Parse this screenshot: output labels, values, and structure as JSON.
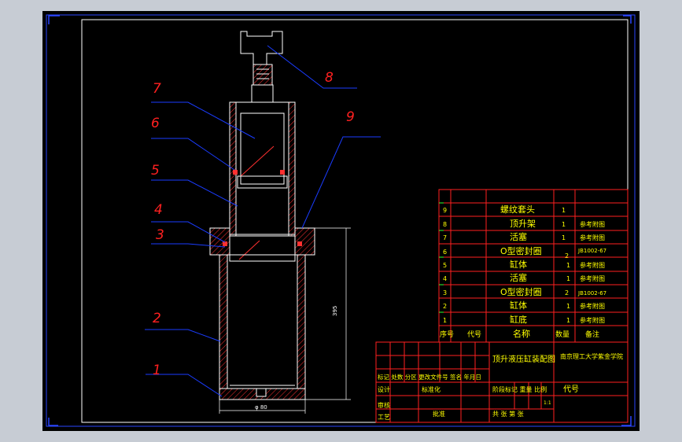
{
  "drawing": {
    "balloons": [
      "1",
      "2",
      "3",
      "4",
      "5",
      "6",
      "7",
      "8",
      "9"
    ],
    "dimensions": {
      "height": "395",
      "diameter": "φ 80"
    }
  },
  "bom": {
    "rows": [
      {
        "seq": "9",
        "name": "螺纹套头",
        "qty": "1",
        "note": ""
      },
      {
        "seq": "8",
        "name": "顶升架",
        "qty": "1",
        "note": "参考附图"
      },
      {
        "seq": "7",
        "name": "活塞",
        "qty": "1",
        "note": "参考附图"
      },
      {
        "seq": "6",
        "name": "O型密封圈",
        "qty": "2",
        "note": "JB1002-67"
      },
      {
        "seq": "5",
        "name": "缸体",
        "qty": "1",
        "note": "参考附图"
      },
      {
        "seq": "4",
        "name": "活塞",
        "qty": "1",
        "note": "参考附图"
      },
      {
        "seq": "3",
        "name": "O型密封圈",
        "qty": "2",
        "note": "JB1002-67"
      },
      {
        "seq": "2",
        "name": "缸体",
        "qty": "1",
        "note": "参考附图"
      },
      {
        "seq": "1",
        "name": "缸底",
        "qty": "1",
        "note": "参考附图"
      }
    ],
    "header": {
      "seq": "序号",
      "code": "代号",
      "name": "名称",
      "qty": "数量",
      "note": "备注"
    }
  },
  "title_block": {
    "title": "顶升液压缸装配图",
    "org": "南京理工大学紫金学院",
    "code_label": "代号",
    "revision_row": "标记 处数 分区 更改文件号 签名 年月日",
    "design": "设计",
    "std": "标准化",
    "stage": "阶段标记 重量 比例",
    "scale": "1:1",
    "review": "审核",
    "process": "工艺",
    "approve": "批准",
    "sheets": "共 张 第 张"
  },
  "colors": {
    "line": "#ffffff",
    "hatch": "#ff3030",
    "leader": "#1a3cff",
    "table": "#ff2020",
    "text": "#ffff00",
    "balloon": "#ff2020"
  }
}
